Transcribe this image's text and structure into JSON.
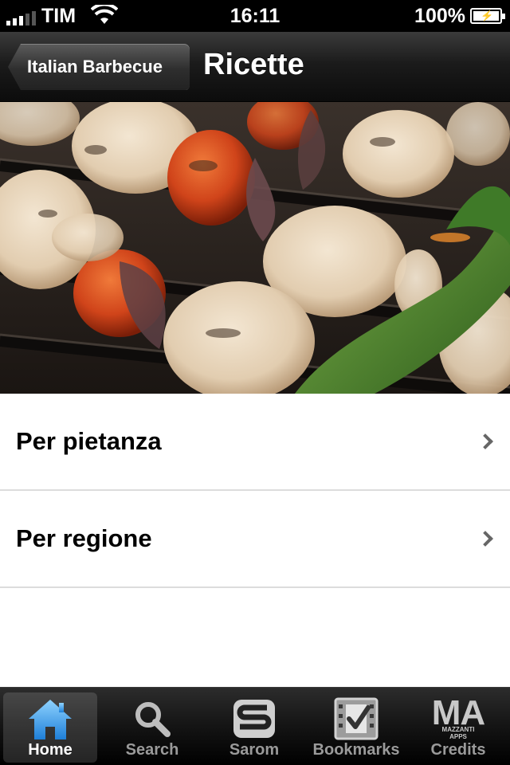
{
  "status_bar": {
    "carrier": "TIM",
    "time": "16:11",
    "battery": "100%",
    "battery_level": 1.0
  },
  "nav": {
    "back_label": "Italian Barbecue",
    "title": "Ricette"
  },
  "menu": {
    "items": [
      {
        "label": "Per pietanza"
      },
      {
        "label": "Per regione"
      }
    ]
  },
  "tabs": [
    {
      "label": "Home",
      "icon": "house-icon",
      "active": true
    },
    {
      "label": "Search",
      "icon": "magnifier-icon",
      "active": false
    },
    {
      "label": "Sarom",
      "icon": "sarom-logo-icon",
      "active": false
    },
    {
      "label": "Bookmarks",
      "icon": "checkbox-icon",
      "active": false
    },
    {
      "label": "Credits",
      "icon": "mazzanti-apps-logo-icon",
      "active": false
    }
  ],
  "credits_logo": {
    "main": "MA",
    "sub": "MAZZANTI APPS"
  },
  "colors": {
    "nav_bg": "#1b1b1b",
    "home_icon": "#4aa8f0",
    "chevron": "#666666"
  }
}
